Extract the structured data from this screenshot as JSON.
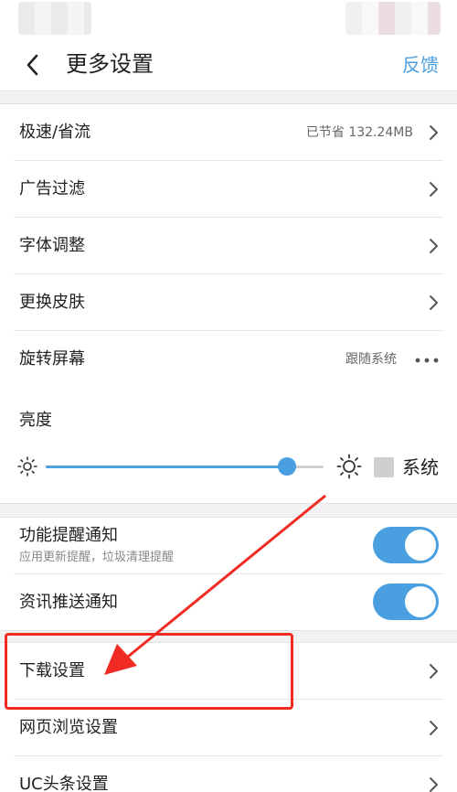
{
  "header": {
    "title": "更多设置",
    "feedback_label": "反馈"
  },
  "settings_group1": [
    {
      "label": "极速/省流",
      "value": "已节省 132.24MB",
      "control": "chevron"
    },
    {
      "label": "广告过滤",
      "value": "",
      "control": "chevron"
    },
    {
      "label": "字体调整",
      "value": "",
      "control": "chevron"
    },
    {
      "label": "更换皮肤",
      "value": "",
      "control": "chevron"
    },
    {
      "label": "旋转屏幕",
      "value": "跟随系统",
      "control": "more-dots"
    }
  ],
  "brightness": {
    "label": "亮度",
    "level": 0.87,
    "follow_system_label": "系统",
    "follow_system_checked": false
  },
  "notifications": [
    {
      "label": "功能提醒通知",
      "sub": "应用更新提醒，垃圾清理提醒",
      "enabled": true
    },
    {
      "label": "资讯推送通知",
      "enabled": true
    }
  ],
  "settings_group2": [
    {
      "label": "下载设置",
      "control": "chevron",
      "highlighted": true
    },
    {
      "label": "网页浏览设置",
      "control": "chevron"
    },
    {
      "label": "UC头条设置",
      "control": "chevron"
    }
  ],
  "colors": {
    "accent": "#4a9fe0",
    "annotation": "#f02b24"
  }
}
